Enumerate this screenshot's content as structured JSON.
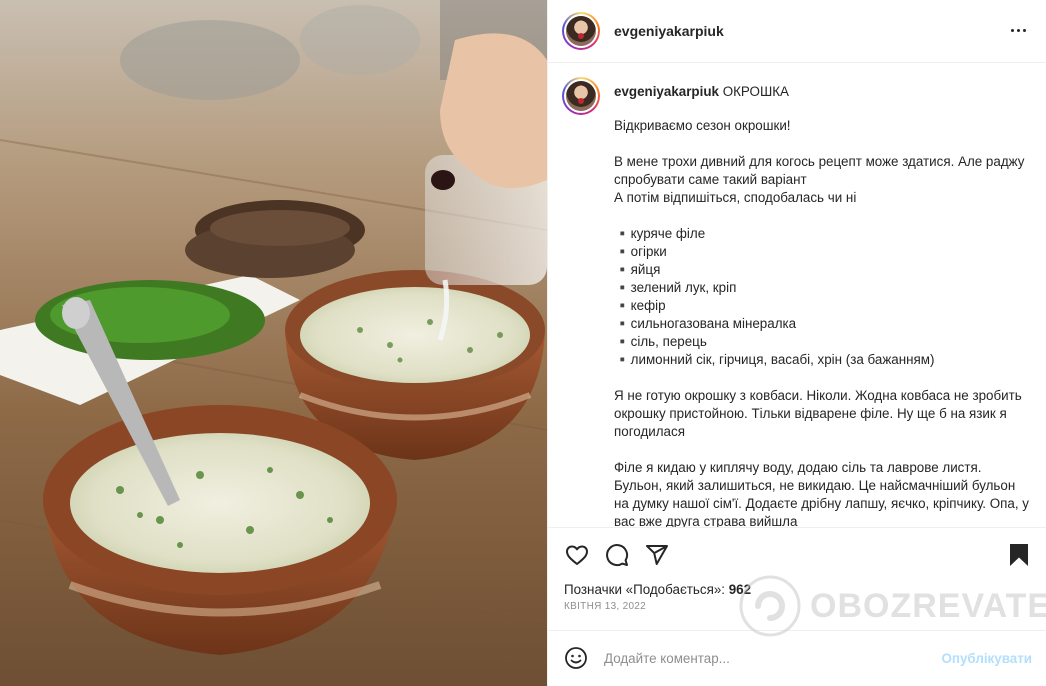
{
  "post": {
    "username": "evgeniyakarpiuk",
    "caption": {
      "author": "evgeniyakarpiuk",
      "title": "ОКРОШКА",
      "text": "Відкриваємо сезон окрошки!\n\nВ мене трохи дивний для когось рецепт може здатися. Але раджу спробувати саме такий варіант\nА потім відпишіться, сподобалась чи ні\n\n▪️куряче філе\n▪️огірки\n▪️яйця\n▪️зелений лук, кріп\n▪️кефір\n▪️сильногазована мінералка\n▪️сіль, перець\n▪️лимонний сік, гірчиця, васабі, хрін (за бажанням)\n\nЯ не готую окрошку з ковбаси. Ніколи. Жодна ковбаса не зробить окрошку пристойною. Тільки відварене філе. Ну ще б на язик я погодилася\n\nФіле я кидаю у киплячу воду, додаю сіль та лаврове листя. Бульон, який залишиться, не викидаю. Це найсмачніший бульон на думку нашої сім'ї. Додаєте дрібну лапшу, яєчко, кріпчику. Опа, у вас вже друга страва вийшла"
    },
    "likes_label": "Позначки «Подобається»:",
    "likes_count": "962",
    "date": "квітня 13, 2022",
    "comment_placeholder": "Додайте коментар...",
    "publish_label": "Опублікувати"
  },
  "watermark": {
    "text": "OBOZREVATEL"
  },
  "icons": {
    "more": "more-options-icon",
    "like": "heart-icon",
    "comment": "comment-icon",
    "share": "send-icon",
    "save": "bookmark-icon",
    "emoji": "emoji-icon"
  },
  "colors": {
    "publish_disabled": "#b2dffc",
    "text": "#262626",
    "muted": "#8e8e8e"
  }
}
